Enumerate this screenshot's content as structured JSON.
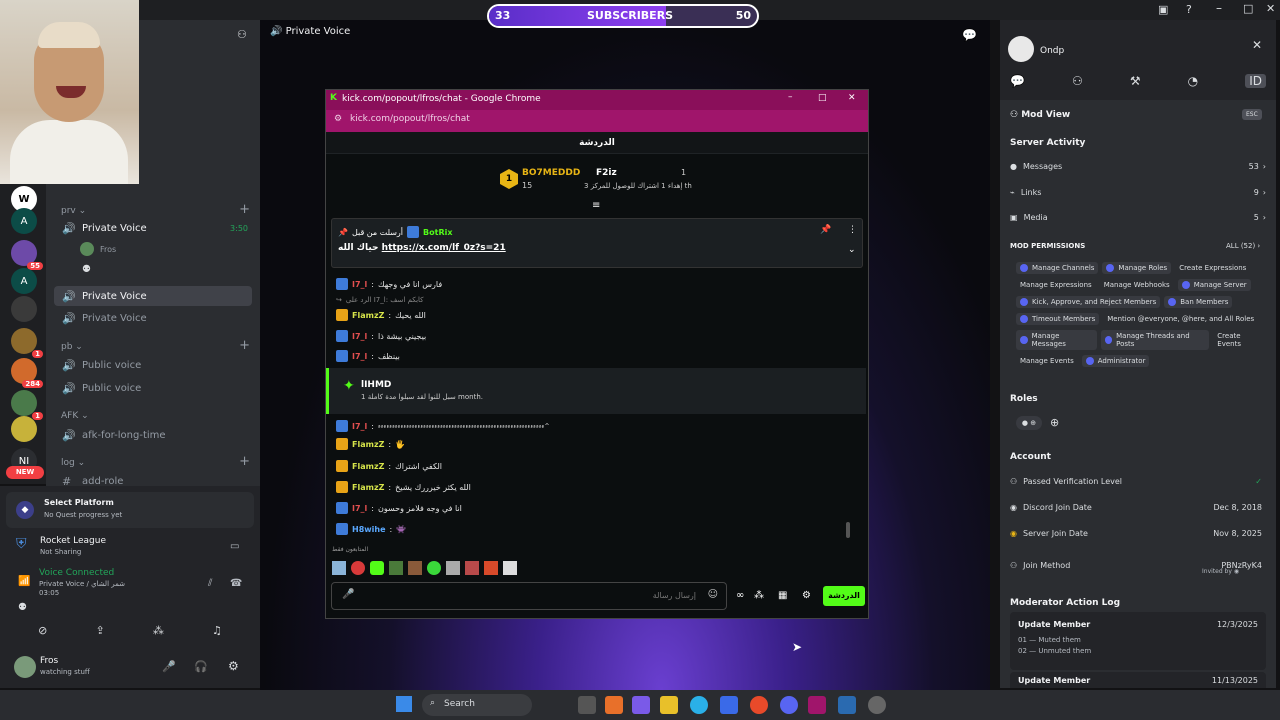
{
  "overlay": {
    "sub_current": "33",
    "sub_label": "SUBSCRIBERS",
    "sub_goal": "50",
    "progress": 0.66
  },
  "main": {
    "channel_title": "Private Voice"
  },
  "left": {
    "servers": [
      {
        "label": "W"
      },
      {
        "label": "A"
      },
      {
        "label": "",
        "badge": "55"
      },
      {
        "label": "A"
      },
      {
        "label": ""
      },
      {
        "label": "",
        "badge": "1"
      },
      {
        "label": "",
        "badge": "284"
      },
      {
        "label": "",
        "badge": "1"
      },
      {
        "label": ""
      },
      {
        "label": "NI"
      }
    ],
    "new_badge": "NEW",
    "categories": [
      {
        "name": "prv"
      },
      {
        "name": "pb"
      },
      {
        "name": "AFK"
      },
      {
        "name": "log"
      }
    ],
    "channels": [
      {
        "name": "Private Voice",
        "timer": "3:50"
      },
      {
        "name": "Private Voice"
      },
      {
        "name": "Private Voice"
      },
      {
        "name": "Public voice"
      },
      {
        "name": "Public voice"
      },
      {
        "name": "afk-for-long-time"
      },
      {
        "name": "add-role"
      }
    ],
    "voice_user": "Fros",
    "platform_title": "Select Platform",
    "platform_sub": "No Quest progress yet",
    "game_title": "Rocket League",
    "game_sub": "Not Sharing",
    "voice_status": "Voice Connected",
    "voice_channel": "Private Voice / شمر الشاي",
    "voice_time": "03:05",
    "user_name": "Fros",
    "user_status": "watching stuff"
  },
  "chrome": {
    "title": "kick.com/popout/lfros/chat - Google Chrome",
    "url": "kick.com/popout/lfros/chat",
    "chat_name": "الدردشة",
    "leader1_name": "BO7MEDDD",
    "leader1_rank": "1",
    "leader1_count": "15",
    "leader2_name": "F2iz",
    "leader2_count": "1",
    "leader2_text": "إهداء 1 اشتراك للوصول للمركز 3 th",
    "pinned_header": "أرسلت من قبل",
    "pinned_user": "BotRix",
    "pinned_prefix": "حياك الله",
    "pinned_link": "https://x.com/lf_0z?s=21",
    "messages": [
      {
        "user": "I7_l",
        "text": "فارس انا في وجهك",
        "badge": "b"
      },
      {
        "user": "",
        "text": "الرد على I7_l: كابكم اسف",
        "badge": "reply"
      },
      {
        "user": "FlamzZ",
        "text": "الله يحيك",
        "badge": "c"
      },
      {
        "user": "I7_l",
        "text": "بيجيني بيشة ذا",
        "badge": "b"
      },
      {
        "user": "I7_l",
        "text": "بينظف",
        "badge": "b"
      }
    ],
    "sub_user": "lIHMD",
    "sub_text": "سبل للنوا لقد سبلوا مدة كاملة 1 month.",
    "messages2": [
      {
        "user": "I7_l",
        "text": "ءءءءءءءءءءءءءءءءءءءءءءءءءءءءءءءءءءءءءءءءءءءءءءءءءءءءءءءءءءء^",
        "badge": "b"
      },
      {
        "user": "FlamzZ",
        "text": "🖐",
        "badge": "c"
      },
      {
        "user": "FlamzZ",
        "text": "الكفي اشتراك",
        "badge": "c"
      },
      {
        "user": "FlamzZ",
        "text": "الله يكثر خيرررك يشيخ",
        "badge": "c"
      },
      {
        "user": "I7_l",
        "text": "انا في وجه فلامز وحسون",
        "badge": "b"
      },
      {
        "user": "H8wihe",
        "text": "👾",
        "badge": "b"
      }
    ],
    "followers_only": "المتابعون فقط",
    "input_placeholder": "إرسال رسالة",
    "send_label": "الدردشة"
  },
  "right": {
    "username": "Ondp",
    "mod_view": "Mod View",
    "esc": "ESC",
    "server_activity": "Server Activity",
    "activity": [
      {
        "label": "Messages",
        "value": "53"
      },
      {
        "label": "Links",
        "value": "9"
      },
      {
        "label": "Media",
        "value": "5"
      }
    ],
    "mod_permissions": "MOD PERMISSIONS",
    "all_perms": "ALL (52)",
    "perm_lines": [
      [
        {
          "t": "Manage Channels",
          "i": true
        },
        {
          "t": "Manage Roles",
          "i": true
        },
        {
          "t": "Create Expressions",
          "i": false
        }
      ],
      [
        {
          "t": "Manage Expressions",
          "i": false
        },
        {
          "t": "Manage Webhooks",
          "i": false
        },
        {
          "t": "Manage Server",
          "i": true
        }
      ],
      [
        {
          "t": "Kick, Approve, and Reject Members",
          "i": true
        },
        {
          "t": "Ban Members",
          "i": true
        }
      ],
      [
        {
          "t": "Timeout Members",
          "i": true
        },
        {
          "t": "Mention @everyone, @here, and All Roles",
          "i": false
        }
      ],
      [
        {
          "t": "Manage Messages",
          "i": true
        },
        {
          "t": "Manage Threads and Posts",
          "i": true
        },
        {
          "t": "Create Events",
          "i": false
        }
      ],
      [
        {
          "t": "Manage Events",
          "i": false
        },
        {
          "t": "Administrator",
          "i": true
        }
      ]
    ],
    "roles": "Roles",
    "account": "Account",
    "acct_rows": [
      {
        "label": "Passed Verification Level",
        "value": "✓"
      },
      {
        "label": "Discord Join Date",
        "value": "Dec 8, 2018"
      },
      {
        "label": "Server Join Date",
        "value": "Nov 8, 2025"
      },
      {
        "label": "Join Method",
        "value": "PBNzRyK4"
      }
    ],
    "invited_by": "Invited by",
    "mod_log": "Moderator Action Log",
    "log_entries": [
      {
        "title": "Update Member",
        "date": "12/3/2025",
        "lines": [
          "01 — Muted them",
          "02 — Unmuted them"
        ]
      },
      {
        "title": "Update Member",
        "date": "11/13/2025",
        "lines": []
      }
    ]
  },
  "taskbar": {
    "search": "Search"
  },
  "colors": {
    "kick_green": "#53fc18",
    "discord_blurple": "#5865f2",
    "chrome_bar": "#8a0f5a"
  }
}
